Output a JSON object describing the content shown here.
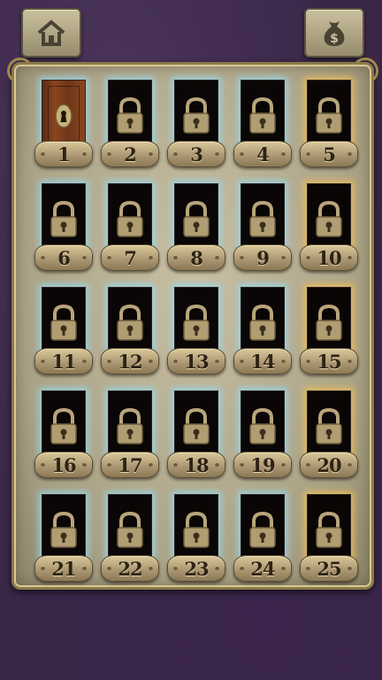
{
  "top_bar": {
    "home_icon": "home-icon",
    "shop_icon": "money-bag-icon"
  },
  "colors": {
    "background": "#3a2748",
    "board": "#b3aa8d",
    "glow_locked": "#96d7eb",
    "glow_row_end": "#ebbe5a",
    "door_wood": "#8a4520"
  },
  "levels": [
    {
      "number": "1",
      "state": "unlocked"
    },
    {
      "number": "2",
      "state": "locked"
    },
    {
      "number": "3",
      "state": "locked"
    },
    {
      "number": "4",
      "state": "locked"
    },
    {
      "number": "5",
      "state": "locked"
    },
    {
      "number": "6",
      "state": "locked"
    },
    {
      "number": "7",
      "state": "locked"
    },
    {
      "number": "8",
      "state": "locked"
    },
    {
      "number": "9",
      "state": "locked"
    },
    {
      "number": "10",
      "state": "locked"
    },
    {
      "number": "11",
      "state": "locked"
    },
    {
      "number": "12",
      "state": "locked"
    },
    {
      "number": "13",
      "state": "locked"
    },
    {
      "number": "14",
      "state": "locked"
    },
    {
      "number": "15",
      "state": "locked"
    },
    {
      "number": "16",
      "state": "locked"
    },
    {
      "number": "17",
      "state": "locked"
    },
    {
      "number": "18",
      "state": "locked"
    },
    {
      "number": "19",
      "state": "locked"
    },
    {
      "number": "20",
      "state": "locked"
    },
    {
      "number": "21",
      "state": "locked"
    },
    {
      "number": "22",
      "state": "locked"
    },
    {
      "number": "23",
      "state": "locked"
    },
    {
      "number": "24",
      "state": "locked"
    },
    {
      "number": "25",
      "state": "locked"
    }
  ]
}
